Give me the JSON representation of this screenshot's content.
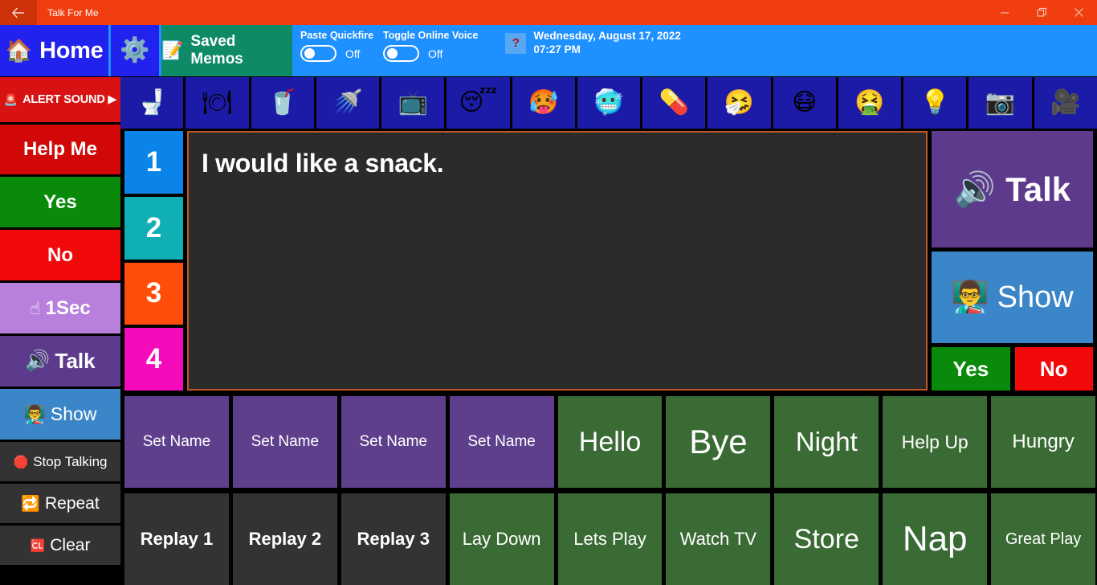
{
  "window": {
    "title": "Talk For Me",
    "back_icon": "back-arrow-icon",
    "minimize_label": "—",
    "restore_label": "❐",
    "close_label": "✕",
    "titlebar_color": "#F03E11"
  },
  "header": {
    "home": {
      "label": "Home",
      "icon": "house-icon"
    },
    "settings": {
      "icon": "gear-icon"
    },
    "saved_memos": {
      "label": "Saved Memos",
      "icon": "memo-icon"
    },
    "toggles": [
      {
        "label": "Paste Quickfire",
        "state": "Off"
      },
      {
        "label": "Toggle Online Voice",
        "state": "Off"
      }
    ],
    "help": {
      "icon": "question-mark-icon",
      "glyph": "?"
    },
    "date": "Wednesday, August 17, 2022",
    "time": "07:27 PM",
    "accent_color": "#1E90FF"
  },
  "sidebar": {
    "items": [
      {
        "label": "ALERT SOUND ▶",
        "icon": "siren-icon",
        "glyph": "🚨",
        "color": "#D81212",
        "class": "r-alert"
      },
      {
        "label": "Help Me",
        "icon": "",
        "glyph": "",
        "color": "#D20808",
        "class": "r-help"
      },
      {
        "label": "Yes",
        "icon": "",
        "glyph": "",
        "color": "#0A8A0A",
        "class": "r-yes"
      },
      {
        "label": "No",
        "icon": "",
        "glyph": "",
        "color": "#F20A0A",
        "class": "r-no"
      },
      {
        "label": "1Sec",
        "icon": "pointing-finger-icon",
        "glyph": "☝",
        "color": "#B87FDD",
        "class": "r-sec"
      },
      {
        "label": "Talk",
        "icon": "speaker-icon",
        "glyph": "🔊",
        "color": "#5E3A8C",
        "class": "r-talk"
      },
      {
        "label": "Show",
        "icon": "presenter-icon",
        "glyph": "👨‍🏫",
        "color": "#3A86C8",
        "class": "r-show"
      },
      {
        "label": "Stop Talking",
        "icon": "stop-octagon-icon",
        "glyph": "🛑",
        "color": "#333333",
        "class": "r-stop"
      },
      {
        "label": "Repeat",
        "icon": "repeat-icon",
        "glyph": "🔁",
        "color": "#333333",
        "class": "r-repeat"
      },
      {
        "label": "Clear",
        "icon": "cl-button-icon",
        "glyph": "🆑",
        "color": "#333333",
        "class": "r-clear"
      }
    ]
  },
  "emoji_bar": {
    "tile_color": "#1B1BA8",
    "items": [
      {
        "name": "toilet-icon",
        "glyph": "🚽"
      },
      {
        "name": "fork-and-knife-icon",
        "glyph": "🍽"
      },
      {
        "name": "cup-with-straw-icon",
        "glyph": "🥤"
      },
      {
        "name": "shower-icon",
        "glyph": "🚿"
      },
      {
        "name": "television-icon",
        "glyph": "📺"
      },
      {
        "name": "sleeping-face-icon",
        "glyph": "😴"
      },
      {
        "name": "hot-face-icon",
        "glyph": "🥵"
      },
      {
        "name": "cold-face-icon",
        "glyph": "🥶"
      },
      {
        "name": "pill-icon",
        "glyph": "💊"
      },
      {
        "name": "sneezing-face-icon",
        "glyph": "🤧"
      },
      {
        "name": "mask-face-icon",
        "glyph": "😷"
      },
      {
        "name": "vomiting-face-icon",
        "glyph": "🤮"
      },
      {
        "name": "light-bulb-icon",
        "glyph": "💡"
      },
      {
        "name": "camera-icon",
        "glyph": "📷"
      },
      {
        "name": "movie-camera-icon",
        "glyph": "🎥"
      }
    ]
  },
  "number_tiles": [
    {
      "label": "1",
      "color": "#0A84E8"
    },
    {
      "label": "2",
      "color": "#0FAFB4"
    },
    {
      "label": "3",
      "color": "#FF4D0A"
    },
    {
      "label": "4",
      "color": "#F50ABC"
    }
  ],
  "message": {
    "value": "I would like a snack.",
    "placeholder": "",
    "background": "#2B2B2B",
    "border_color": "#C05528"
  },
  "actions": {
    "talk": {
      "label": "Talk",
      "icon": "speaker-icon",
      "glyph": "🔊",
      "color": "#5E3A8C"
    },
    "show": {
      "label": "Show",
      "icon": "presenter-icon",
      "glyph": "👨‍🏫",
      "color": "#3A86C8"
    },
    "yes": {
      "label": "Yes",
      "color": "#0A8A0A"
    },
    "no": {
      "label": "No",
      "color": "#F20A0A"
    }
  },
  "grid": {
    "row1": [
      {
        "label": "Set Name",
        "style": "purple",
        "size": 19
      },
      {
        "label": "Set Name",
        "style": "purple",
        "size": 19
      },
      {
        "label": "Set Name",
        "style": "purple",
        "size": 19
      },
      {
        "label": "Set Name",
        "style": "purple",
        "size": 19
      },
      {
        "label": "Hello",
        "style": "green",
        "size": 34
      },
      {
        "label": "Bye",
        "style": "green",
        "size": 42
      },
      {
        "label": "Night",
        "style": "green",
        "size": 33
      },
      {
        "label": "Help Up",
        "style": "green",
        "size": 23
      },
      {
        "label": "Hungry",
        "style": "green",
        "size": 24
      }
    ],
    "row2": [
      {
        "label": "Replay 1",
        "style": "gray",
        "size": 22
      },
      {
        "label": "Replay 2",
        "style": "gray",
        "size": 22
      },
      {
        "label": "Replay 3",
        "style": "gray",
        "size": 22
      },
      {
        "label": "Lay Down",
        "style": "green",
        "size": 22
      },
      {
        "label": "Lets Play",
        "style": "green",
        "size": 22
      },
      {
        "label": "Watch TV",
        "style": "green",
        "size": 22
      },
      {
        "label": "Store",
        "style": "green",
        "size": 34
      },
      {
        "label": "Nap",
        "style": "green",
        "size": 44
      },
      {
        "label": "Great Play",
        "style": "green",
        "size": 20
      }
    ]
  }
}
